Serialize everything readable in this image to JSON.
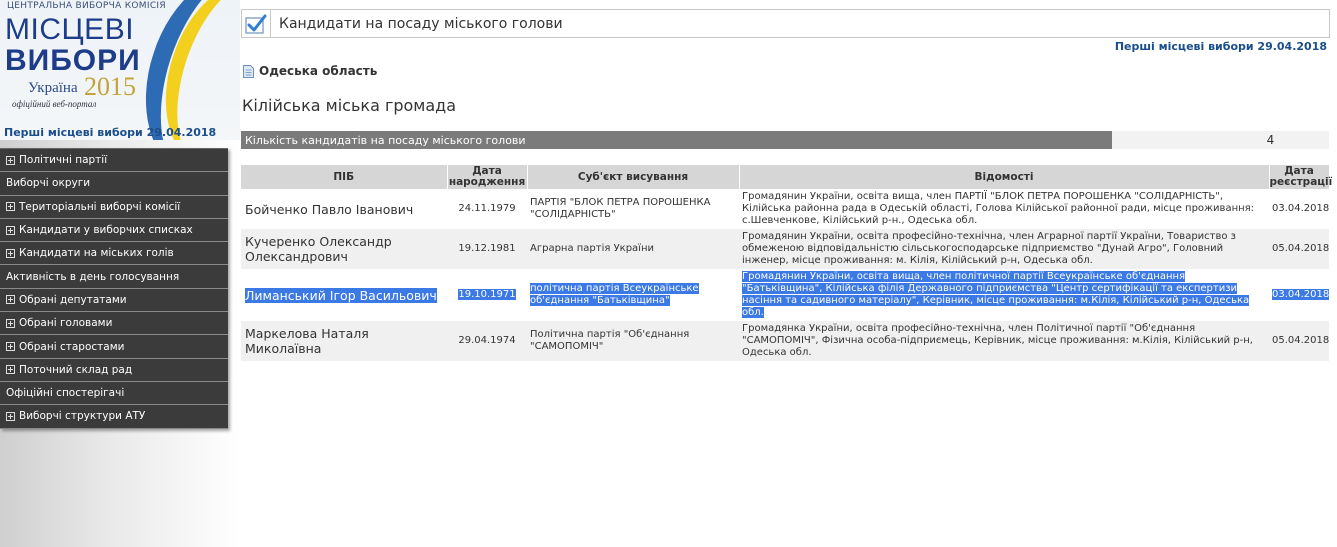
{
  "logo": {
    "top_text": "ЦЕНТРАЛЬНА ВИБОРЧА КОМІСІЯ",
    "line1": "МІСЦЕВІ",
    "line2": "ВИБОРИ",
    "country": "Україна",
    "year": "2015",
    "subtitle": "офіційний веб-портал"
  },
  "sidebar": {
    "elections_link": "Перші місцеві вибори 29.04.2018",
    "menu": [
      {
        "label": "Політичні партії",
        "expandable": true
      },
      {
        "label": "Виборчі округи",
        "expandable": false
      },
      {
        "label": "Територіальні виборчі комісії",
        "expandable": true
      },
      {
        "label": "Кандидати у виборчих списках",
        "expandable": true
      },
      {
        "label": "Кандидати на міських голів",
        "expandable": true
      },
      {
        "label": "Активність в день голосування",
        "expandable": false
      },
      {
        "label": "Обрані депутатами",
        "expandable": true
      },
      {
        "label": "Обрані головами",
        "expandable": true
      },
      {
        "label": "Обрані старостами",
        "expandable": true
      },
      {
        "label": "Поточний склад рад",
        "expandable": true
      },
      {
        "label": "Офіційні спостерігачі",
        "expandable": false
      },
      {
        "label": "Виборчі структури АТУ",
        "expandable": true
      }
    ]
  },
  "header": {
    "title": "Кандидати на посаду міського голови",
    "elections_link": "Перші місцеві вибори 29.04.2018"
  },
  "region": "Одеська область",
  "community": "Кілійська міська громада",
  "count": {
    "label": "Кількість кандидатів на посаду міського голови",
    "value": "4"
  },
  "table": {
    "headers": [
      "ПІБ",
      "Дата народження",
      "Суб'єкт висування",
      "Відомості",
      "Дата реєстрації"
    ],
    "rows": [
      {
        "name": "Бойченко Павло Іванович",
        "birth": "24.11.1979",
        "nominator": "ПАРТІЯ \"БЛОК ПЕТРА ПОРОШЕНКА \"СОЛІДАРНІСТЬ\"",
        "info": "Громадянин України, освіта вища, член ПАРТІЇ \"БЛОК ПЕТРА ПОРОШЕНКА \"СОЛІДАРНІСТЬ\", Кілійська районна рада в Одеській області, Голова Кілійської районної ради, місце проживання: с.Шевченкове, Кілійський р-н., Одеська обл.",
        "reg": "03.04.2018",
        "selected": false
      },
      {
        "name": "Кучеренко Олександр Олександрович",
        "birth": "19.12.1981",
        "nominator": "Аграрна партія України",
        "info": "Громадянин України, освіта професійно-технічна, член Аграрної партії України, Товариство з обмеженою відповідальністю сільськогосподарське підприємство \"Дунай Агро\", Головний інженер, місце проживання: м. Кілія, Кілійський р-н, Одеська обл.",
        "reg": "05.04.2018",
        "selected": false
      },
      {
        "name": "Лиманський Ігор Васильович",
        "birth": "19.10.1971",
        "nominator": "політична партія Всеукраїнське об'єднання \"Батьківщина\"",
        "info": "Громадянин України, освіта вища, член політичної партії Всеукраїнське об'єднання \"Батьківщина\", Кілійська філія Державного підприємства \"Центр сертифікації та експертизи насіння та садивного матеріалу\", Керівник, місце проживання: м.Кілія, Кілійський р-н, Одеська обл.",
        "reg": "03.04.2018",
        "selected": true
      },
      {
        "name": "Маркелова Наталя Миколаївна",
        "birth": "29.04.1974",
        "nominator": "Політична партія \"Об'єднання \"САМОПОМІЧ\"",
        "info": "Громадянка України, освіта професійно-технічна, член Політичної партії \"Об'єднання \"САМОПОМІЧ\", Фізична особа-підприємець, Керівник, місце проживання: м.Кілія, Кілійський р-н, Одеська обл.",
        "reg": "05.04.2018",
        "selected": false
      }
    ]
  },
  "colors": {
    "menu_bg": "#3b3b3b",
    "link_blue": "#1a4e8c",
    "selection": "#3b79e4",
    "count_bar": "#7b7b7b",
    "table_header": "#d6d6d6"
  }
}
